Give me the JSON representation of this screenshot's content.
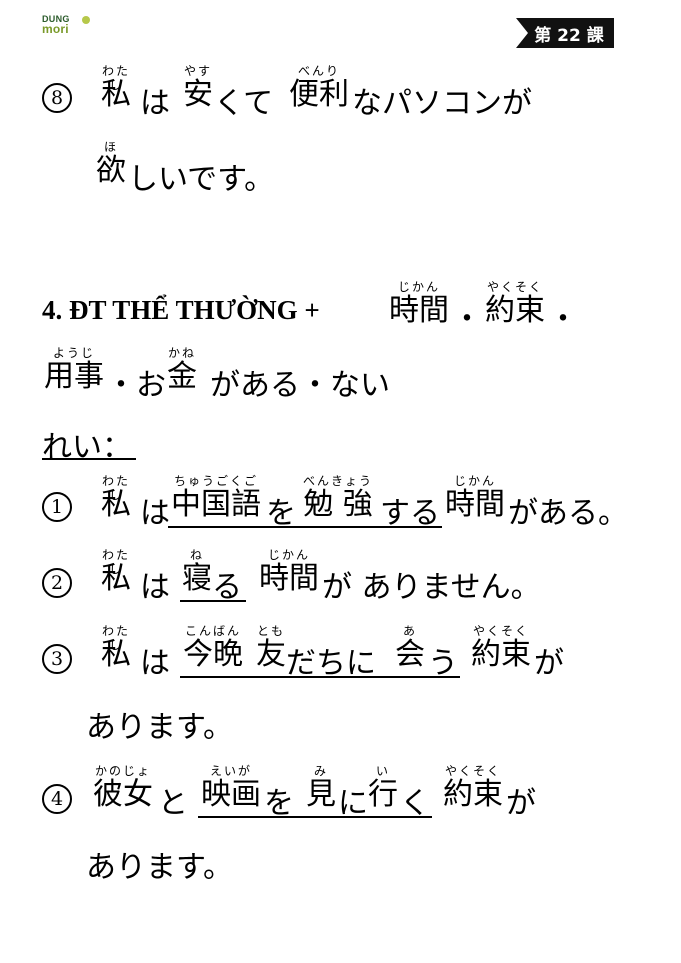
{
  "logo": {
    "line1": "DUNG",
    "line2": "mori"
  },
  "lesson_badge": "第 22 課",
  "top_example": {
    "num": "8",
    "part1": {
      "ruby": "わたし",
      "base": "私"
    },
    "part2": "は",
    "part3": {
      "ruby": "やす",
      "base": "安"
    },
    "part4": "くて",
    "part5": {
      "ruby": "べんり",
      "base": "便利"
    },
    "part6": "なパソコンが",
    "line2_ruby": "ほ",
    "line2_base": "欲",
    "line2_rest": "しいです。"
  },
  "section": {
    "heading_text": "4. ĐT THỂ THƯỜNG +",
    "w1": {
      "ruby": "じかん",
      "base": "時間"
    },
    "dot1": "・",
    "w2": {
      "ruby": "やくそく",
      "base": "約束"
    },
    "dot2": "・",
    "w3": {
      "ruby": "ようじ",
      "base": "用事"
    },
    "dot3": "・お",
    "w4": {
      "ruby": "かね",
      "base": "金"
    },
    "rest": "がある・ない"
  },
  "rei_label": "れい：",
  "examples": [
    {
      "num": "1",
      "a": {
        "ruby": "わたし",
        "base": "私"
      },
      "b": "は",
      "c": {
        "ruby": "ちゅうごくご",
        "base": "中国語"
      },
      "d": "を",
      "e": {
        "ruby": "べんきょう",
        "base": "勉 強"
      },
      "f": "する",
      "g": {
        "ruby": "じかん",
        "base": "時間"
      },
      "h": "がある。"
    },
    {
      "num": "2",
      "a": {
        "ruby": "わたし",
        "base": "私"
      },
      "b": "は",
      "c": {
        "ruby": "ね",
        "base": "寝"
      },
      "d": "る",
      "e": {
        "ruby": "じかん",
        "base": "時間"
      },
      "f": "が ありません。"
    },
    {
      "num": "3",
      "a": {
        "ruby": "わたし",
        "base": "私"
      },
      "b": "は",
      "c": {
        "ruby": "こんばん",
        "base": "今晩"
      },
      "d": {
        "ruby": "とも",
        "base": "友"
      },
      "e": "だちに",
      "f": {
        "ruby": "あ",
        "base": "会"
      },
      "g": "う",
      "h": {
        "ruby": "やくそく",
        "base": "約束"
      },
      "i": "が",
      "line2": "あります。"
    },
    {
      "num": "4",
      "a": {
        "ruby": "かのじょ",
        "base": "彼女"
      },
      "b": "と",
      "c": {
        "ruby": "えいが",
        "base": "映画"
      },
      "d": "を",
      "e": {
        "ruby": "み",
        "base": "見"
      },
      "f": "に",
      "g": {
        "ruby": "い",
        "base": "行"
      },
      "h": "く",
      "i": {
        "ruby": "やくそく",
        "base": "約束"
      },
      "j": "が",
      "line2": "あります。"
    }
  ]
}
